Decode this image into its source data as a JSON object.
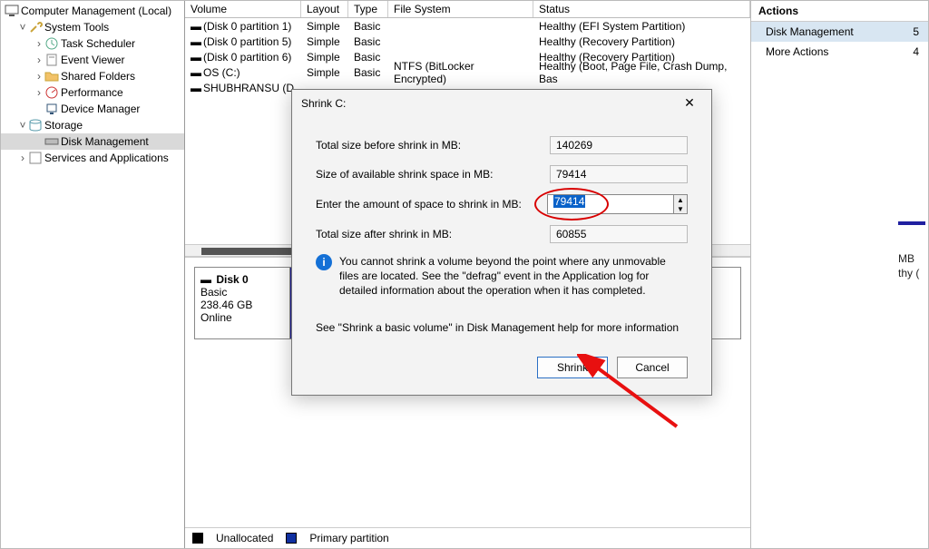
{
  "tree": {
    "root": "Computer Management (Local)",
    "system_tools": "System Tools",
    "task_scheduler": "Task Scheduler",
    "event_viewer": "Event Viewer",
    "shared_folders": "Shared Folders",
    "performance": "Performance",
    "device_manager": "Device Manager",
    "storage": "Storage",
    "disk_management": "Disk Management",
    "services_apps": "Services and Applications"
  },
  "table": {
    "headers": {
      "volume": "Volume",
      "layout": "Layout",
      "type": "Type",
      "fs": "File System",
      "status": "Status"
    },
    "rows": [
      {
        "vol": "(Disk 0 partition 1)",
        "lay": "Simple",
        "typ": "Basic",
        "fs": "",
        "st": "Healthy (EFI System Partition)"
      },
      {
        "vol": "(Disk 0 partition 5)",
        "lay": "Simple",
        "typ": "Basic",
        "fs": "",
        "st": "Healthy (Recovery Partition)"
      },
      {
        "vol": "(Disk 0 partition 6)",
        "lay": "Simple",
        "typ": "Basic",
        "fs": "",
        "st": "Healthy (Recovery Partition)"
      },
      {
        "vol": "OS (C:)",
        "lay": "Simple",
        "typ": "Basic",
        "fs": "NTFS (BitLocker Encrypted)",
        "st": "Healthy (Boot, Page File, Crash Dump, Bas"
      },
      {
        "vol": "SHUBHRANSU (D",
        "lay": "",
        "typ": "",
        "fs": "",
        "st": ""
      }
    ]
  },
  "disk": {
    "name": "Disk 0",
    "type": "Basic",
    "size": "238.46 GB",
    "status": "Online",
    "peek_line1": "MB",
    "peek_line2": "thy ("
  },
  "legend": {
    "unallocated": "Unallocated",
    "primary": "Primary partition"
  },
  "actions": {
    "title": "Actions",
    "disk_mgmt_label": "Disk Management",
    "disk_mgmt_badge": "5",
    "more_label": "More Actions",
    "more_badge": "4"
  },
  "dialog": {
    "title": "Shrink C:",
    "label_total_before": "Total size before shrink in MB:",
    "label_available": "Size of available shrink space in MB:",
    "label_enter": "Enter the amount of space to shrink in MB:",
    "label_total_after": "Total size after shrink in MB:",
    "val_total_before": "140269",
    "val_available": "79414",
    "val_enter": "79414",
    "val_total_after": "60855",
    "info_text": "You cannot shrink a volume beyond the point where any unmovable files are located. See the \"defrag\" event in the Application log for detailed information about the operation when it has completed.",
    "help_text": "See \"Shrink a basic volume\" in Disk Management help for more information",
    "btn_shrink": "Shrink",
    "btn_cancel": "Cancel"
  }
}
